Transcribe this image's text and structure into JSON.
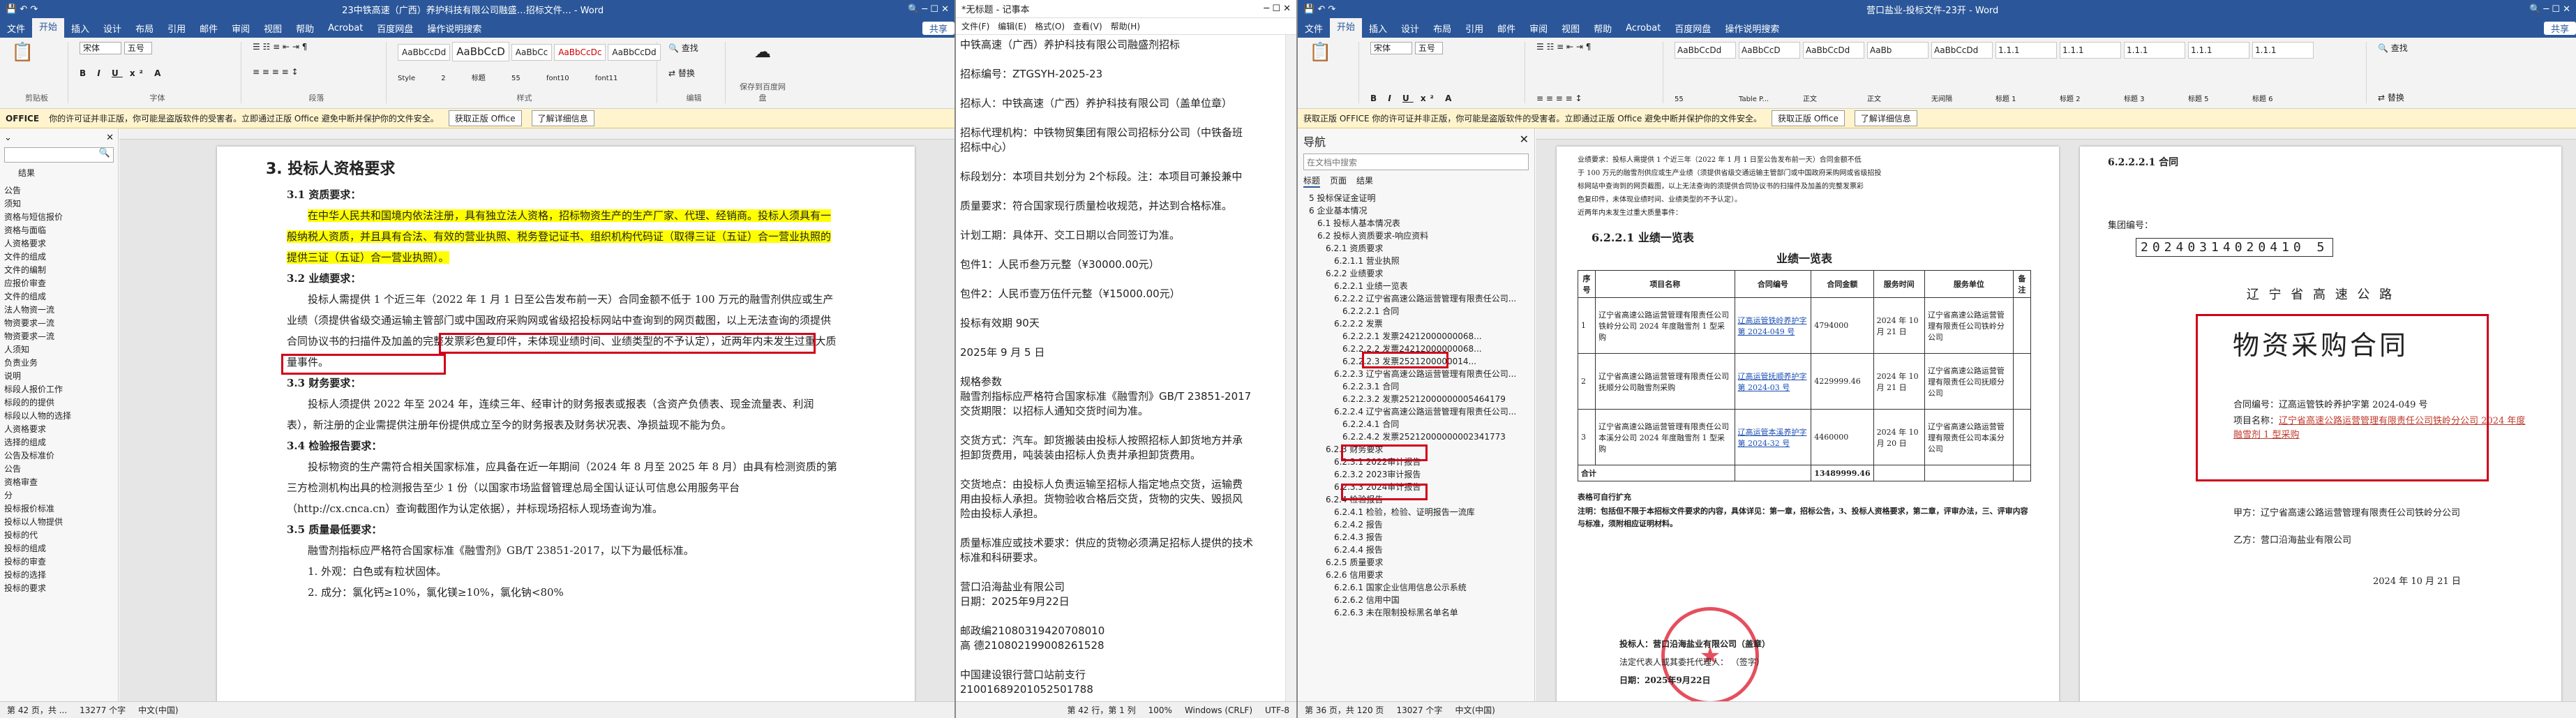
{
  "word1": {
    "title": "23中铁高速（广西）养护科技有限公司融盛…招标文件… - Word",
    "tabs": [
      "文件",
      "开始",
      "插入",
      "设计",
      "布局",
      "引用",
      "邮件",
      "审阅",
      "视图",
      "帮助",
      "Acrobat",
      "百度网盘",
      "操作说明搜索"
    ],
    "share": "共享",
    "font_name": "宋体",
    "font_size": "五号",
    "styles": [
      "AaBbCcDd",
      "AaBbCcD",
      "AaBbCc",
      "AaBbCcDc",
      "AaBbCcDd"
    ],
    "style_names": [
      "Style 2",
      "标题",
      "55",
      "font10",
      "font11"
    ],
    "groups": [
      "剪贴板",
      "字体",
      "段落",
      "样式",
      "编辑",
      "保存到百度网盘"
    ],
    "msg": "你的许可证并非正版，你可能是盗版软件的受害者。立即通过正版 Office 避免中断并保护你的文件安全。",
    "msg_label": "OFFICE",
    "msg_btn1": "获取正版 Office",
    "msg_btn2": "了解详细信息",
    "nav_tab": "结果",
    "nav_items": [
      "公告",
      "须知",
      "资格与短信报价",
      "资格与面临",
      "人资格要求",
      "文件的组成",
      "文件的编制",
      "应报价审查",
      "文件的组成",
      "法人物资一流",
      "物资要求—流",
      "物资要求—流",
      "人须知",
      "负责业务",
      "说明",
      "标段人报价工作",
      "标段的的提供",
      "标段以人物的选择",
      "人资格要求",
      "选择的组成",
      "公告及标准价",
      "公告",
      "资格审查",
      "分",
      "投标报价标准",
      "投标以人物提供",
      "投标的代",
      "投标的组成",
      "投标的审查",
      "投标的选择",
      "投标的要求"
    ],
    "heading": "3. 投标人资格要求",
    "paras": [
      "3.1 资质要求：",
      "在中华人民共和国境内依法注册，具有独立法人资格，招标物资生产的生产厂家、代理、经销商。投标人须具有一般纳税人资质，并且具有合法、有效的营业执照、税务登记证书、组织机构代码证（取得三证（五证）合一营业执照的提供三证（五证）合一营业执照）。",
      "3.2 业绩要求：",
      "投标人需提供 1 个近三年（2022 年 1 月 1 日至公告发布前一天）合同金额不低于 100 万元的融雪剂供应或生产业绩（须提供省级交通运输主管部门或中国政府采购网或省级招投标网站中查询到的网页截图，以上无法查询的须提供合同协议书的扫描件及加盖的完整发票彩色复印件，未体现业绩时间、业绩类型的不予认定），近两年内未发生过重大质量事件。",
      "3.3 财务要求：",
      "投标人须提供 2022 年至 2024 年，连续三年、经审计的财务报表或报表（含资产负债表、现金流量表、利润表），新注册的企业需提供注册年份提供成立至今的财务报表及财务状况表、净损益现不能为负。",
      "3.4 检验报告要求：",
      "投标物资的生产需符合相关国家标准，应具备在近一年期间（2024 年 8 月至 2025 年 8 月）由具有检测资质的第三方检测机构出具的检测报告至少 1 份（以国家市场监督管理总局全国认证认可信息公用服务平台（http://cx.cnca.cn）查询截图作为认定依据），并标现场招标人现场查询为准。",
      "3.5 质量最低要求：",
      "融雪剂指标应严格符合国家标准《融雪剂》GB/T 23851-2017，以下为最低标准。",
      "1. 外观：白色或有粒状固体。",
      "2. 成分：氯化钙≥10%，氯化镁≥10%，氯化钠<80%"
    ],
    "status": [
      "第 42 页，共 ...",
      "13277 个字",
      "中文(中国)"
    ]
  },
  "notepad": {
    "title": "*无标题 - 记事本",
    "menus": [
      "文件(F)",
      "编辑(E)",
      "格式(O)",
      "查看(V)",
      "帮助(H)"
    ],
    "lines": [
      "中铁高速（广西）养护科技有限公司融盛剂招标",
      "",
      "招标编号：ZTGSYH-2025-23",
      "",
      "招标人：中铁高速（广西）养护科技有限公司（盖单位章）",
      "",
      "招标代理机构：中铁物贸集团有限公司招标分公司（中铁备班",
      "招标中心）",
      "",
      "标段划分：本项目共划分为 2个标段。注：本项目可兼投兼中",
      "",
      "质量要求：符合国家现行质量检收规范，并达到合格标准。",
      "",
      "计划工期：具体开、交工日期以合同签订为准。",
      "",
      "包件1：人民币叁万元整（¥30000.00元）",
      "",
      "包件2：人民币壹万伍仟元整（¥15000.00元）",
      "",
      "投标有效期        90天",
      "",
      "2025年 9 月 5 日",
      "",
      "规格参数",
      "融雪剂指标应严格符合国家标准《融雪剂》GB/T 23851-2017",
      "交货期限：以招标人通知交货时间为准。",
      "",
      "交货方式：汽车。卸货搬装由投标人按照招标人卸货地方并承",
      "担卸货费用，吨装装由招标人负责并承担卸货费用。",
      "",
      "交货地点：由投标人负责运输至招标人指定地点交货，运输费",
      "用由投标人承担。货物验收合格后交货，货物的灾失、毁损风",
      "险由投标人承担。",
      "",
      "质量标准应或技术要求：供应的货物必须满足招标人提供的技术",
      "标准和科研要求。",
      "",
      "营口沿海盐业有限公司",
      "日期：2025年9月22日",
      "",
      "邮政编21080319420708010",
      "高   德210802199008261528",
      "",
      "中国建设银行营口站前支行",
      "21001689201052501788"
    ],
    "status": [
      "第 42 行，第 1 列",
      "100%",
      "Windows (CRLF)",
      "UTF-8"
    ]
  },
  "word2": {
    "title": "营口盐业-投标文件-23开 - Word",
    "tabs": [
      "文件",
      "开始",
      "插入",
      "设计",
      "布局",
      "引用",
      "邮件",
      "审阅",
      "视图",
      "帮助",
      "Acrobat",
      "百度网盘",
      "操作说明搜索"
    ],
    "share": "共享",
    "font_name": "宋体",
    "font_size": "五号",
    "styles": [
      "AaBbCcDd",
      "AaBbCcD",
      "AaBbCcDd",
      "AaBb",
      "AaBbCcDd",
      "1.1.1",
      "1.1.1",
      "1.1.1",
      "1.1.1",
      "1.1.1"
    ],
    "style_names": [
      "55",
      "Table P...",
      "正文",
      "正文",
      "无间隔",
      "标题 1",
      "标题 2",
      "标题 3",
      "标题 5",
      "标题 6"
    ],
    "msg": "获取正版 OFFICE 你的许可证并非正版，你可能是盗版软件的受害者。立即通过正版 Office 避免中断并保护你的文件安全。",
    "msg_btn1": "获取正版 Office",
    "msg_btn2": "了解详细信息",
    "nav_title": "导航",
    "nav_search": "在文档中搜索",
    "nav_tabs": [
      "标题",
      "页面",
      "结果"
    ],
    "nav_items": [
      "5 投标保证金证明",
      "6 企业基本情况",
      "6.1 投标人基本情况表",
      "6.2 投标人资质要求-响应资料",
      "6.2.1 资质要求",
      "6.2.1.1 营业执照",
      "6.2.2 业绩要求",
      "6.2.2.1 业绩一览表",
      "6.2.2.2 辽宁省高速公路运营管理有限责任公司...",
      "6.2.2.2.1 合同",
      "6.2.2.2 发票",
      "6.2.2.2.1 发票24212000000068...",
      "6.2.2.2.2 发票24212000000068...",
      "6.2.2.2.3 发票2521200000014...",
      "6.2.2.3 辽宁省高速公路运营管理有限责任公司...",
      "6.2.2.3.1 合同",
      "6.2.2.3.2 发票25212000000005464179",
      "6.2.2.4 辽宁省高速公路运营管理有限责任公司...",
      "6.2.2.4.1 合同",
      "6.2.2.4.2 发票25212000000002341773",
      "6.2.3 财务要求",
      "6.2.3.1 2022审计报告",
      "6.2.3.2 2023审计报告",
      "6.2.3.3 2024审计报告",
      "6.2.4 检验报告",
      "6.2.4.1 检验，检验、证明报告一流库",
      "6.2.4.2 报告",
      "6.2.4.3 报告",
      "6.2.4.4 报告",
      "6.2.5 质量要求",
      "6.2.6 信用要求",
      "6.2.6.1 国家企业信用信息公示系统",
      "6.2.6.2 信用中国",
      "6.2.6.3 未在限制投标黑名单名单"
    ],
    "page_intro": [
      "业绩要求：投标人需提供 1 个近三年（2022 年 1 月 1 日至公告发布前一天）合同金额不低",
      "于 100 万元的融雪剂供应或生产业绩（须提供省级交通运输主管部门或中国政府采购网或省级招投",
      "标网站中查询到的网页截图，以上无法查询的须提供合同协议书的扫描件及加盖的完整发票彩",
      "色复印件，未体现业绩时间、业绩类型的不予认定）。",
      "近两年内未发生过重大质量事件："
    ],
    "sec_heading": "6.2.2.1  业绩一览表",
    "table_title": "业绩一览表",
    "table_headers": [
      "序号",
      "项目名称",
      "合同编号",
      "合同金额",
      "服务时间",
      "服务单位",
      "备注"
    ],
    "table_rows": [
      [
        "1",
        "辽宁省高速公路运营管理有限责任公司铁岭分公司 2024 年度融雪剂 1 型采购",
        "辽高运管铁岭养护字第 2024-049 号",
        "4794000",
        "2024 年 10 月 21 日",
        "辽宁省高速公路运营管理有限责任公司铁岭分公司",
        ""
      ],
      [
        "2",
        "辽宁省高速公路运营管理有限责任公司抚顺分公司融雪剂采购",
        "辽高运管抚顺养护字第 2024-03 号",
        "4229999.46",
        "2024 年 10 月 21 日",
        "辽宁省高速公路运营管理有限责任公司抚顺分公司",
        ""
      ],
      [
        "3",
        "辽宁省高速公路运营管理有限责任公司本溪分公司 2024 年度融雪剂 1 型采购",
        "辽高运管本溪养护字第 2024-32 号",
        "4460000",
        "2024 年 10 月 20 日",
        "辽宁省高速公路运营管理有限责任公司本溪分公司",
        ""
      ]
    ],
    "table_total_label": "合计",
    "table_total": "13489999.46",
    "notes": [
      "表格可自行扩充",
      "注明：包括但不限于本招标文件要求的内容，具体详见：第一章，招标公告，3、投标人资格要求，第二章，评审办法，三、评审内容与标准，须附相应证明材料。"
    ],
    "sign": [
      "投标人：营口沿海盐业有限公司（盖章）",
      "法定代表人或其委托代理人：                （签字）",
      "日期：2025年9月22日"
    ],
    "right_heading": "6.2.2.2.1 合同",
    "contract_no_label": "集团编号：",
    "contract_no": "20240314020410 5",
    "company_header": "辽 宁 省 高 速 公 路",
    "contract_title": "物资采购合同",
    "contract_num_label": "合同编号：辽高运管铁岭养护字第 2024-049 号",
    "project_label": "项目名称：",
    "project_name": "辽宁省高速公路运营管理有限责任公司铁岭分公司 2024 年度融雪剂 1 型采购",
    "party_a": "甲方：辽宁省高速公路运营管理有限责任公司铁岭分公司",
    "party_b": "乙方：营口沿海盐业有限公司",
    "contract_date": "2024 年 10 月 21 日",
    "status": [
      "第 36 页，共 120 页",
      "13027 个字",
      "中文(中国)"
    ]
  },
  "colors": {
    "word_blue": "#2b579a",
    "highlight": "#ffff00",
    "box_red": "#d0021b"
  }
}
